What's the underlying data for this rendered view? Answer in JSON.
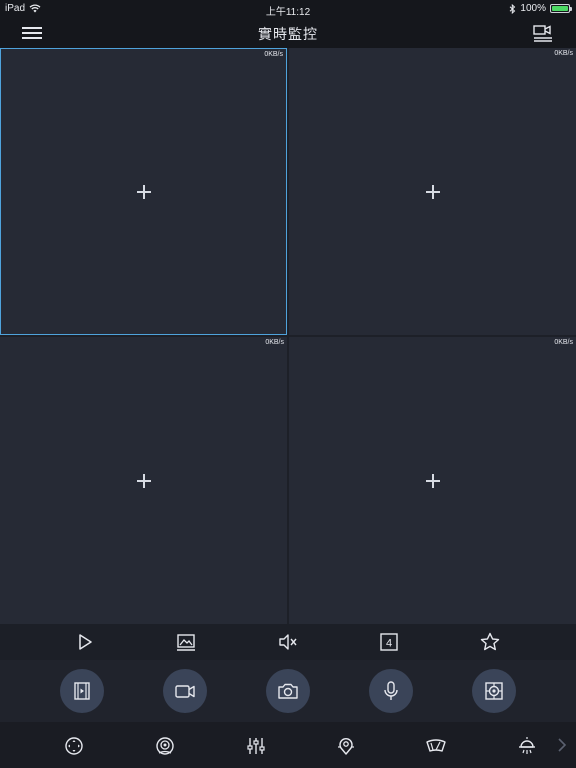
{
  "status_bar": {
    "device": "iPad",
    "time": "上午11:12",
    "battery": "100%",
    "battery_level": 1.0
  },
  "nav": {
    "title": "實時監控"
  },
  "grid": {
    "cells": [
      {
        "rate": "0KB/s",
        "selected": true
      },
      {
        "rate": "0KB/s",
        "selected": false
      },
      {
        "rate": "0KB/s",
        "selected": false
      },
      {
        "rate": "0KB/s",
        "selected": false
      }
    ]
  },
  "toolbar": {
    "split_count": "4"
  },
  "icons": {
    "toolbar": [
      "play-icon",
      "image-icon",
      "mute-icon",
      "split-screen-icon",
      "favorite-star-icon"
    ],
    "actions": [
      "video-record-icon",
      "camera-icon",
      "snapshot-icon",
      "microphone-icon",
      "target-icon"
    ],
    "ptz": [
      "ptz-direction-icon",
      "eye-icon",
      "sliders-icon",
      "location-icon",
      "wiper-icon",
      "light-icon"
    ]
  },
  "colors": {
    "background": "#1a1c23",
    "cell": "#262a35",
    "selected_border": "#4fa3dc",
    "action_button": "#3a4458",
    "battery": "#4cd964"
  }
}
